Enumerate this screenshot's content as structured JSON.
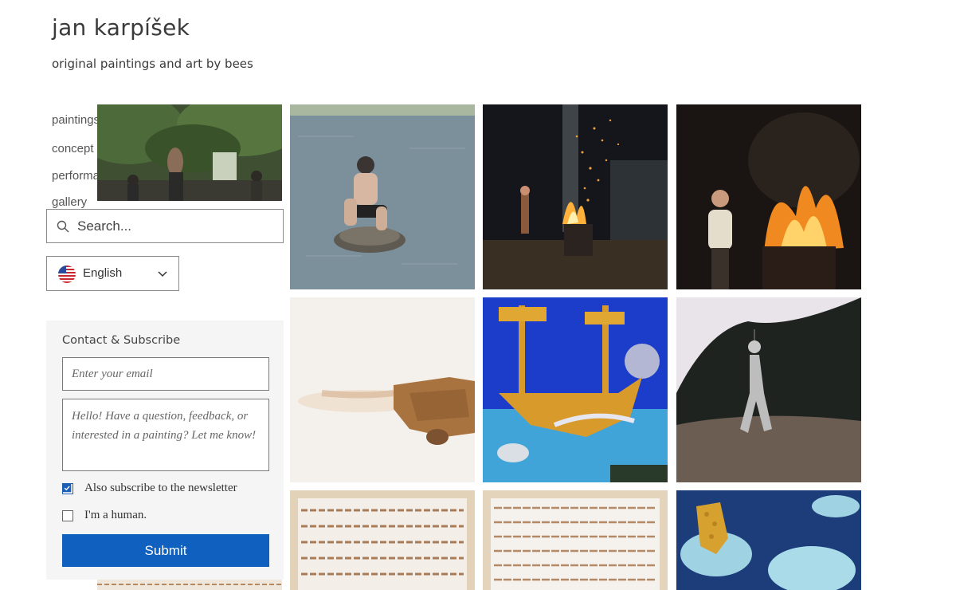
{
  "header": {
    "title": "jan karpíšek",
    "tagline": "original paintings and art by bees"
  },
  "nav": {
    "items": [
      {
        "label": "paintings"
      },
      {
        "label": "concept art"
      },
      {
        "label": "performance"
      },
      {
        "label": "gallery"
      }
    ]
  },
  "search": {
    "placeholder": "Search...",
    "icon": "search-icon"
  },
  "language": {
    "selected": "English",
    "flag": "us-flag-icon",
    "icon": "chevron-down-icon"
  },
  "contact": {
    "title": "Contact & Subscribe",
    "email_placeholder": "Enter your email",
    "message_placeholder": "Hello! Have a question, feedback, or interested in a painting? Let me know!",
    "subscribe_label": "Also subscribe to the newsletter",
    "subscribe_checked": true,
    "human_label": "I'm a human.",
    "human_checked": false,
    "submit_label": "Submit"
  },
  "gallery": {
    "items": [
      {
        "subject": "performance with figures under trees"
      },
      {
        "subject": "man sitting on rock in water"
      },
      {
        "subject": "fire barrel with sparks at night"
      },
      {
        "subject": "man beside burning fire barrel"
      },
      {
        "subject": "abstract rusty form on white"
      },
      {
        "subject": "child painting of golden ship"
      },
      {
        "subject": "white figure walking in dark landscape"
      },
      {
        "subject": "rust striped framed canvas"
      },
      {
        "subject": "rust striped framed canvas"
      },
      {
        "subject": "honeycomb on blue painting"
      }
    ]
  },
  "colors": {
    "accent": "#1060c0",
    "panel_bg": "#f5f5f5",
    "text": "#333333"
  }
}
